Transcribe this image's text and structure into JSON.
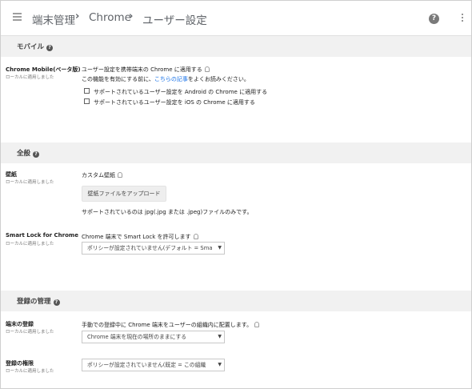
{
  "breadcrumb": {
    "root": "端末管理",
    "section": "Chrome",
    "page": "ユーザー設定"
  },
  "sections": {
    "mobile": {
      "title": "モバイル"
    },
    "general": {
      "title": "全般"
    },
    "enrollment": {
      "title": "登録の管理"
    }
  },
  "settings": {
    "chrome_mobile": {
      "name": "Chrome Mobile(ベータ版)",
      "sub": "ローカルに適用しました",
      "desc": "ユーザー設定を携帯端末の Chrome に適用する",
      "note_prefix": "この機能を有効にする前に、",
      "note_link": "こちらの記事",
      "note_suffix": "をよくお読みください。",
      "options": [
        {
          "label": "サポートされているユーザー設定を Android の Chrome に適用する",
          "checked": false
        },
        {
          "label": "サポートされているユーザー設定を iOS の Chrome に適用する",
          "checked": false
        }
      ]
    },
    "wallpaper": {
      "name": "壁紙",
      "sub": "ローカルに適用しました",
      "label": "カスタム壁紙",
      "button": "壁紙ファイルをアップロード",
      "note": "サポートされているのは jpg(.jpg または .jpeg)ファイルのみです。"
    },
    "smart_lock": {
      "name": "Smart Lock for Chrome",
      "sub": "ローカルに適用しました",
      "label": "Chrome 端末で Smart Lock を許可します",
      "select": "ポリシーが設定されていません(デフォルト = Sma"
    },
    "device_enroll": {
      "name": "端末の登録",
      "sub": "ローカルに適用しました",
      "label": "手動での登録中に Chrome 端末をユーザーの組織内に配置します。",
      "select": "Chrome 端末を現在の場所のままにする"
    },
    "enroll_permission": {
      "name": "登録の権限",
      "sub": "ローカルに適用しました",
      "select": "ポリシーが設定されていません(既定 = この組織"
    }
  },
  "icons": {
    "help": "help-circle-icon",
    "more": "more-vert-icon",
    "menu": "hamburger-menu-icon",
    "tip": "lightbulb-icon"
  }
}
